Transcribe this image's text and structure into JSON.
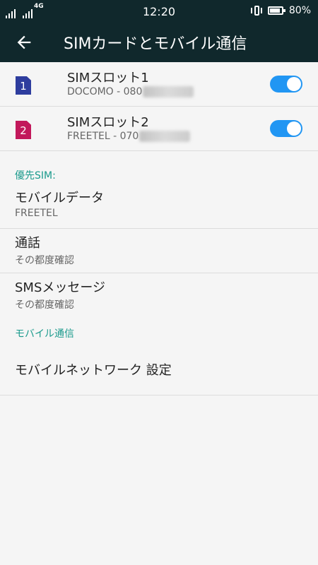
{
  "status": {
    "network": "4G",
    "time": "12:20",
    "battery": "80%",
    "battery_level": 0.8
  },
  "appbar": {
    "title": "SIMカードとモバイル通信",
    "back_icon": "arrow-left-icon"
  },
  "sim_slots": [
    {
      "label": "SIMスロット1",
      "number": "1",
      "carrier_prefix": "DOCOMO - 080",
      "enabled": true,
      "color": "#2e3d9e"
    },
    {
      "label": "SIMスロット2",
      "number": "2",
      "carrier_prefix": "FREETEL - 070",
      "enabled": true,
      "color": "#c2185b"
    }
  ],
  "preferred": {
    "header": "優先SIM:",
    "items": [
      {
        "title": "モバイルデータ",
        "value": "FREETEL"
      },
      {
        "title": "通話",
        "value": "その都度確認"
      },
      {
        "title": "SMSメッセージ",
        "value": "その都度確認"
      }
    ]
  },
  "mobile": {
    "header": "モバイル通信",
    "network_settings": "モバイルネットワーク 設定"
  },
  "colors": {
    "appbar": "#10282c",
    "accent": "#1a9a8c",
    "toggle": "#2196f3"
  }
}
